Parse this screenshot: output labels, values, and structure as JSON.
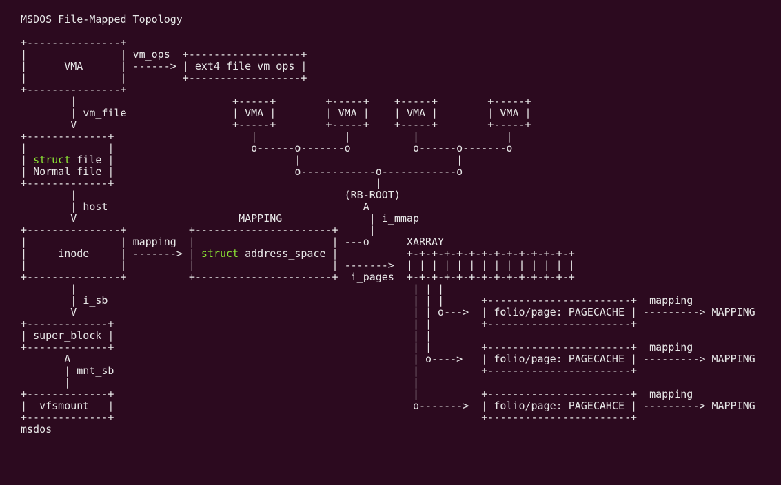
{
  "title": "MSDOS File-Mapped Topology",
  "footer": "msdos",
  "keywords": {
    "struct": "struct"
  },
  "boxes": {
    "vma": "VMA",
    "ext4_ops": "ext4_file_vm_ops",
    "file_line1_post_kw": " file",
    "file_line2": "Normal file",
    "inode": "inode",
    "address_space_post_kw": " address_space",
    "super_block": "super_block",
    "vfsmount": "vfsmount",
    "folio1": "folio/page: PAGECACHE",
    "folio2": "folio/page: PAGECACHE",
    "folio3": "folio/page: PAGECAHCE"
  },
  "labels": {
    "vm_ops": "vm_ops",
    "vm_file": "vm_file",
    "host": "host",
    "mapping_center": "MAPPING",
    "mapping_arrow": "mapping",
    "i_mmap": "i_mmap",
    "rb_root": "(RB-ROOT)",
    "xarray": "XARRAY",
    "i_pages": "i_pages",
    "i_sb": "i_sb",
    "mnt_sb": "mnt_sb",
    "mapping_right": "mapping",
    "mapping_target": "MAPPING"
  }
}
